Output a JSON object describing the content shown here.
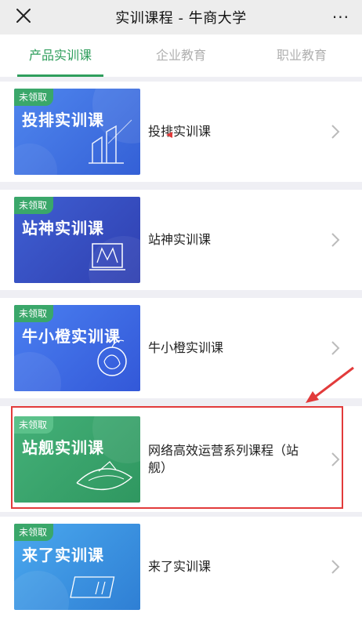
{
  "header": {
    "title": "实训课程 - 牛商大学",
    "close_icon": "close-icon",
    "more_icon": "more-icon",
    "more_label": "···"
  },
  "tabs": [
    {
      "label": "产品实训课",
      "active": true
    },
    {
      "label": "企业教育",
      "active": false
    },
    {
      "label": "职业教育",
      "active": false
    }
  ],
  "courses": [
    {
      "badge": "未领取",
      "thumb_title": "投排实训课",
      "name": "投排实训课",
      "theme": "blue",
      "icon": "building-icon"
    },
    {
      "badge": "未领取",
      "thumb_title": "站神实训课",
      "name": "站神实训课",
      "theme": "indigo",
      "icon": "platform-icon"
    },
    {
      "badge": "未领取",
      "thumb_title": "牛小橙实训课",
      "name": "牛小橙实训课",
      "theme": "blue",
      "icon": "orange-icon"
    },
    {
      "badge": "未领取",
      "thumb_title": "站舰实训课",
      "name": "网络高效运营系列课程（站舰）",
      "theme": "green",
      "icon": "ship-icon",
      "highlighted": true
    },
    {
      "badge": "未领取",
      "thumb_title": "来了实训课",
      "name": "来了实训课",
      "theme": "cyan",
      "icon": "sss-icon"
    }
  ],
  "colors": {
    "accent": "#2f9e5c",
    "highlight": "#e23b3b",
    "blue": "#3d6fe0",
    "indigo": "#3a4fc4",
    "green": "#3ea96e",
    "cyan": "#3b97dc"
  }
}
